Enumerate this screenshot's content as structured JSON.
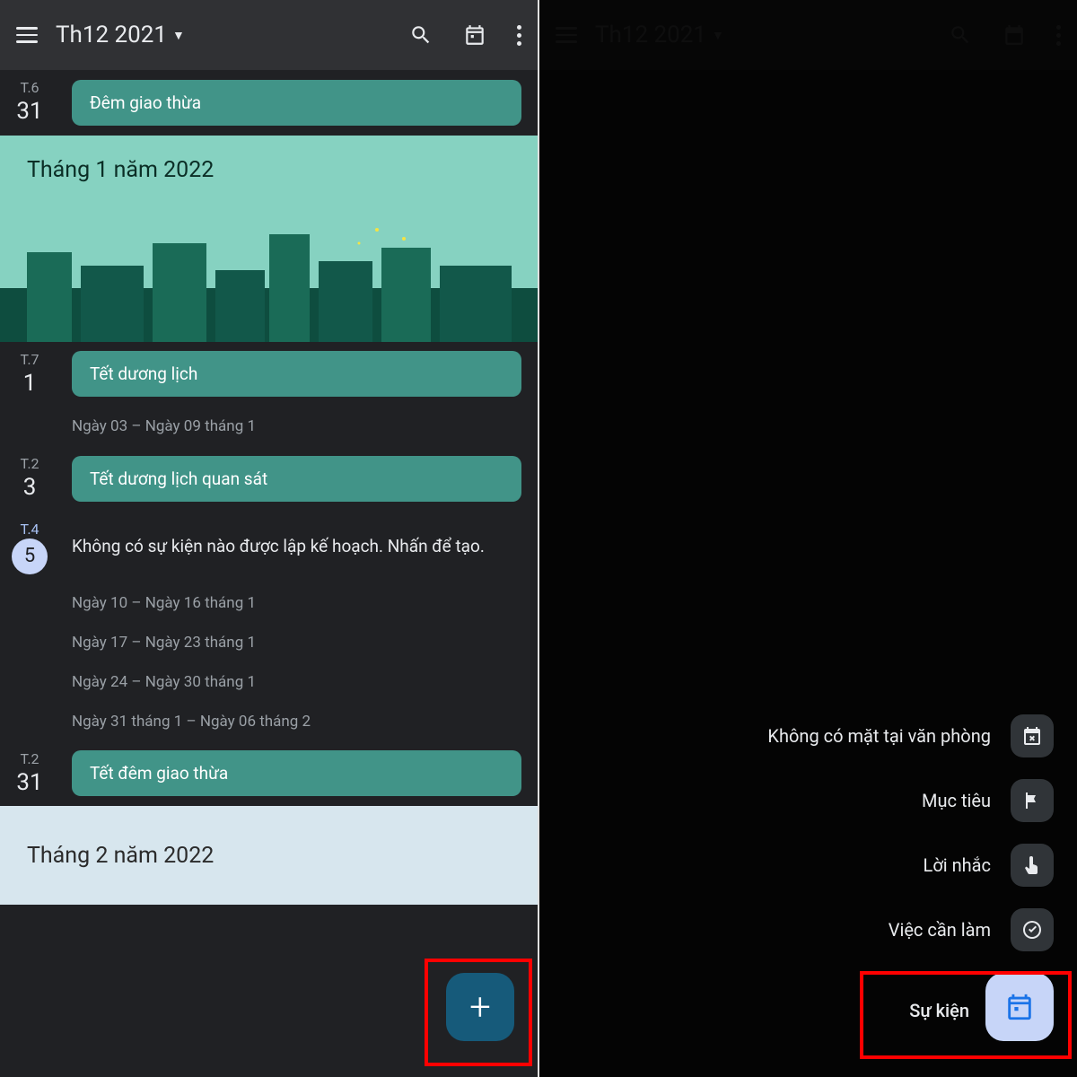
{
  "header": {
    "title": "Th12 2021"
  },
  "left": {
    "rows": [
      {
        "dow": "T.6",
        "num": "31",
        "chip": "Đêm giao thừa"
      }
    ],
    "monthBanner": "Tháng 1 năm 2022",
    "rows2": [
      {
        "dow": "T.7",
        "num": "1",
        "chip": "Tết dương lịch"
      }
    ],
    "week1": "Ngày 03 – Ngày 09 tháng 1",
    "rows3": [
      {
        "dow": "T.2",
        "num": "3",
        "chip": "Tết dương lịch quan sát"
      }
    ],
    "today": {
      "dow": "T.4",
      "num": "5",
      "text": "Không có sự kiện nào được lập kế hoạch. Nhấn để tạo."
    },
    "weeks": [
      "Ngày 10 – Ngày 16 tháng 1",
      "Ngày 17 – Ngày 23 tháng 1",
      "Ngày 24 – Ngày 30 tháng 1",
      "Ngày 31 tháng 1 – Ngày 06 tháng 2"
    ],
    "rows4": [
      {
        "dow": "T.2",
        "num": "31",
        "chip": "Tết đêm giao thừa"
      }
    ],
    "monthBanner2": "Tháng 2 năm 2022"
  },
  "menu": {
    "items": [
      {
        "label": "Không có mặt tại văn phòng",
        "icon": "briefcase-x"
      },
      {
        "label": "Mục tiêu",
        "icon": "flag"
      },
      {
        "label": "Lời nhắc",
        "icon": "finger"
      },
      {
        "label": "Việc cần làm",
        "icon": "check-circle"
      },
      {
        "label": "Sự kiện",
        "icon": "calendar",
        "primary": true
      }
    ]
  }
}
